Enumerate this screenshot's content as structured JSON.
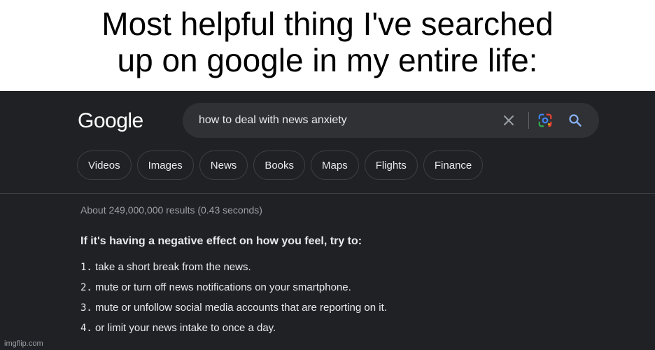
{
  "caption": {
    "line1": "Most helpful thing I've searched",
    "line2": "up on google in my entire life:"
  },
  "header": {
    "logo": "Google",
    "search_query": "how to deal with news anxiety",
    "icons": [
      "close-icon",
      "google-lens-icon",
      "search-icon"
    ]
  },
  "tabs": [
    {
      "label": "Videos"
    },
    {
      "label": "Images"
    },
    {
      "label": "News"
    },
    {
      "label": "Books"
    },
    {
      "label": "Maps"
    },
    {
      "label": "Flights"
    },
    {
      "label": "Finance"
    }
  ],
  "results": {
    "stats": "About 249,000,000 results (0.43 seconds)",
    "snippet_heading": "If it's having a negative effect on how you feel, try to:",
    "steps": [
      {
        "num": "1.",
        "text": "take a short break from the news."
      },
      {
        "num": "2.",
        "text": "mute or turn off news notifications on your smartphone."
      },
      {
        "num": "3.",
        "text": "mute or unfollow social media accounts that are reporting on it."
      },
      {
        "num": "4.",
        "text": "or limit your news intake to once a day."
      }
    ]
  },
  "watermark": "imgflip.com",
  "colors": {
    "background": "#202124",
    "searchbar": "#303134",
    "text_primary": "#e8eaed",
    "text_secondary": "#9aa0a6",
    "border": "#3c4043",
    "accent_blue": "#8ab4f8"
  }
}
